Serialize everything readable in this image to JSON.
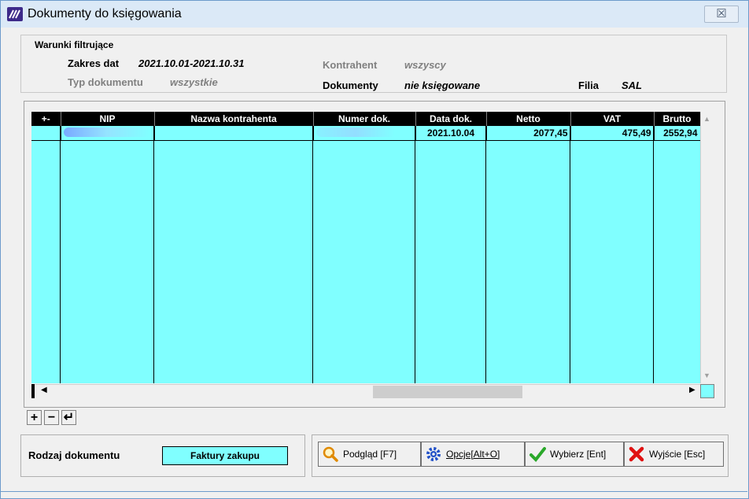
{
  "window": {
    "title": "Dokumenty do księgowania",
    "close_label": "☒"
  },
  "filter": {
    "legend": "Warunki filtrujące",
    "date_range_label": "Zakres dat",
    "date_range_value": "2021.10.01-2021.10.31",
    "doc_type_label": "Typ dokumentu",
    "doc_type_value": "wszystkie",
    "contractor_label": "Kontrahent",
    "contractor_value": "wszyscy",
    "documents_label": "Dokumenty",
    "documents_value": "nie księgowane",
    "branch_label": "Filia",
    "branch_value": "SAL"
  },
  "grid": {
    "columns": [
      "+-",
      "NIP",
      "Nazwa kontrahenta",
      "Numer dok.",
      "Data dok.",
      "Netto",
      "VAT",
      "Brutto"
    ],
    "rows": [
      {
        "nip": "",
        "name": "",
        "number": "",
        "date": "2021.10.04",
        "net": "2077,45",
        "vat": "475,49",
        "gross": "2552,94"
      }
    ]
  },
  "toolbar": {
    "add": "+",
    "remove": "−",
    "refresh": "↵"
  },
  "doc_kind": {
    "label": "Rodzaj dokumentu",
    "value": "Faktury zakupu"
  },
  "actions": {
    "preview": "Podgląd  [F7]",
    "options": "Opcje[Alt+O]",
    "select": "Wybierz  [Ent]",
    "exit": "Wyjście  [Esc]"
  },
  "colors": {
    "grid_bg": "#80ffff",
    "title_bg": "#dbe9f7",
    "header_bg": "#000000"
  }
}
